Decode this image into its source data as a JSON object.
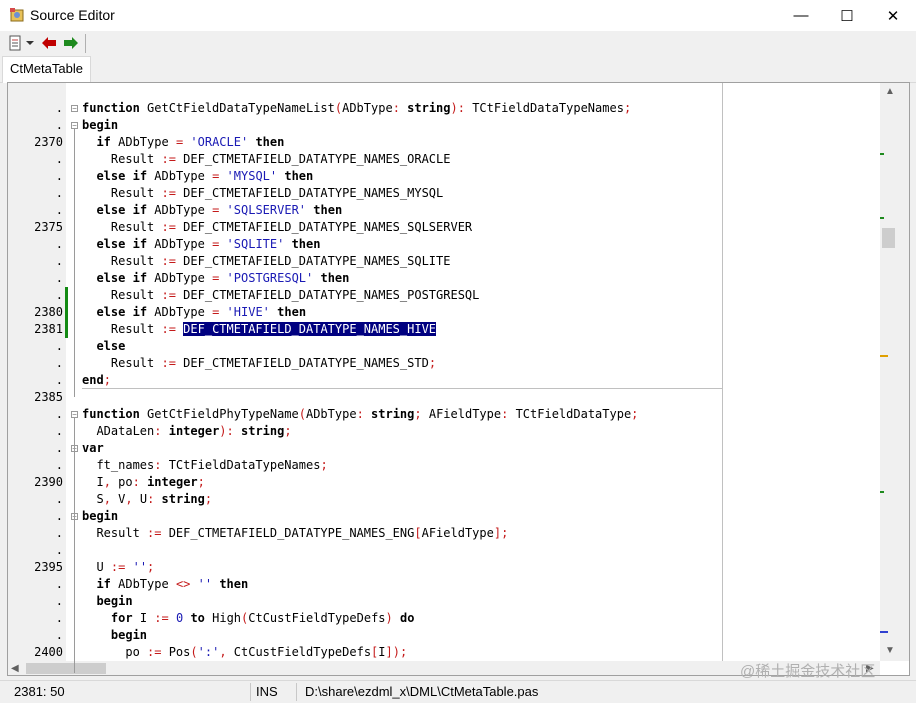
{
  "window": {
    "title": "Source Editor",
    "minimize_glyph": "—",
    "maximize_glyph": "☐",
    "close_glyph": "✕"
  },
  "toolbar": {
    "menu_icon": "document-list-icon",
    "dropdown_icon": "chevron-down-icon",
    "back_icon": "arrow-left-icon",
    "forward_icon": "arrow-right-icon",
    "back_color": "#c00000",
    "forward_color": "#1e8a1e"
  },
  "tab": {
    "label": "CtMetaTable"
  },
  "gutter": [
    ".",
    ".",
    "2370",
    ".",
    ".",
    ".",
    ".",
    "2375",
    ".",
    ".",
    ".",
    ".",
    "2380",
    "2381",
    ".",
    ".",
    ".",
    "2385",
    ".",
    ".",
    ".",
    ".",
    "2390",
    ".",
    ".",
    ".",
    ".",
    "2395",
    ".",
    ".",
    ".",
    ".",
    "2400"
  ],
  "code": [
    [
      {
        "t": "function",
        "k": "kw"
      },
      {
        "t": " GetCtFieldDataTypeNameList"
      },
      {
        "t": "(",
        "k": "sym"
      },
      {
        "t": "ADbType"
      },
      {
        "t": ":",
        "k": "sym"
      },
      {
        "t": " "
      },
      {
        "t": "string",
        "k": "kw"
      },
      {
        "t": ")",
        "k": "sym"
      },
      {
        "t": ":",
        "k": "sym"
      },
      {
        "t": " TCtFieldDataTypeNames"
      },
      {
        "t": ";",
        "k": "sym"
      }
    ],
    [
      {
        "t": "begin",
        "k": "kw"
      }
    ],
    [
      {
        "t": "  "
      },
      {
        "t": "if",
        "k": "kw"
      },
      {
        "t": " ADbType "
      },
      {
        "t": "=",
        "k": "sym"
      },
      {
        "t": " "
      },
      {
        "t": "'ORACLE'",
        "k": "str"
      },
      {
        "t": " "
      },
      {
        "t": "then",
        "k": "kw"
      }
    ],
    [
      {
        "t": "    Result "
      },
      {
        "t": ":=",
        "k": "sym"
      },
      {
        "t": " DEF_CTMETAFIELD_DATATYPE_NAMES_ORACLE"
      }
    ],
    [
      {
        "t": "  "
      },
      {
        "t": "else",
        "k": "kw"
      },
      {
        "t": " "
      },
      {
        "t": "if",
        "k": "kw"
      },
      {
        "t": " ADbType "
      },
      {
        "t": "=",
        "k": "sym"
      },
      {
        "t": " "
      },
      {
        "t": "'MYSQL'",
        "k": "str"
      },
      {
        "t": " "
      },
      {
        "t": "then",
        "k": "kw"
      }
    ],
    [
      {
        "t": "    Result "
      },
      {
        "t": ":=",
        "k": "sym"
      },
      {
        "t": " DEF_CTMETAFIELD_DATATYPE_NAMES_MYSQL"
      }
    ],
    [
      {
        "t": "  "
      },
      {
        "t": "else",
        "k": "kw"
      },
      {
        "t": " "
      },
      {
        "t": "if",
        "k": "kw"
      },
      {
        "t": " ADbType "
      },
      {
        "t": "=",
        "k": "sym"
      },
      {
        "t": " "
      },
      {
        "t": "'SQLSERVER'",
        "k": "str"
      },
      {
        "t": " "
      },
      {
        "t": "then",
        "k": "kw"
      }
    ],
    [
      {
        "t": "    Result "
      },
      {
        "t": ":=",
        "k": "sym"
      },
      {
        "t": " DEF_CTMETAFIELD_DATATYPE_NAMES_SQLSERVER"
      }
    ],
    [
      {
        "t": "  "
      },
      {
        "t": "else",
        "k": "kw"
      },
      {
        "t": " "
      },
      {
        "t": "if",
        "k": "kw"
      },
      {
        "t": " ADbType "
      },
      {
        "t": "=",
        "k": "sym"
      },
      {
        "t": " "
      },
      {
        "t": "'SQLITE'",
        "k": "str"
      },
      {
        "t": " "
      },
      {
        "t": "then",
        "k": "kw"
      }
    ],
    [
      {
        "t": "    Result "
      },
      {
        "t": ":=",
        "k": "sym"
      },
      {
        "t": " DEF_CTMETAFIELD_DATATYPE_NAMES_SQLITE"
      }
    ],
    [
      {
        "t": "  "
      },
      {
        "t": "else",
        "k": "kw"
      },
      {
        "t": " "
      },
      {
        "t": "if",
        "k": "kw"
      },
      {
        "t": " ADbType "
      },
      {
        "t": "=",
        "k": "sym"
      },
      {
        "t": " "
      },
      {
        "t": "'POSTGRESQL'",
        "k": "str"
      },
      {
        "t": " "
      },
      {
        "t": "then",
        "k": "kw"
      }
    ],
    [
      {
        "t": "    Result "
      },
      {
        "t": ":=",
        "k": "sym"
      },
      {
        "t": " DEF_CTMETAFIELD_DATATYPE_NAMES_POSTGRESQL"
      }
    ],
    [
      {
        "t": "  "
      },
      {
        "t": "else",
        "k": "kw"
      },
      {
        "t": " "
      },
      {
        "t": "if",
        "k": "kw"
      },
      {
        "t": " ADbType "
      },
      {
        "t": "=",
        "k": "sym"
      },
      {
        "t": " "
      },
      {
        "t": "'HIVE'",
        "k": "str"
      },
      {
        "t": " "
      },
      {
        "t": "then",
        "k": "kw"
      }
    ],
    [
      {
        "t": "    Result "
      },
      {
        "t": ":=",
        "k": "sym"
      },
      {
        "t": " "
      },
      {
        "t": "DEF_CTMETAFIELD_DATATYPE_NAMES_HIVE",
        "k": "sel"
      }
    ],
    [
      {
        "t": "  "
      },
      {
        "t": "else",
        "k": "kw"
      }
    ],
    [
      {
        "t": "    Result "
      },
      {
        "t": ":=",
        "k": "sym"
      },
      {
        "t": " DEF_CTMETAFIELD_DATATYPE_NAMES_STD"
      },
      {
        "t": ";",
        "k": "sym"
      }
    ],
    [
      {
        "t": "end",
        "k": "kw"
      },
      {
        "t": ";",
        "k": "sym"
      }
    ],
    [
      {
        "t": ""
      }
    ],
    [
      {
        "t": "function",
        "k": "kw"
      },
      {
        "t": " GetCtFieldPhyTypeName"
      },
      {
        "t": "(",
        "k": "sym"
      },
      {
        "t": "ADbType"
      },
      {
        "t": ":",
        "k": "sym"
      },
      {
        "t": " "
      },
      {
        "t": "string",
        "k": "kw"
      },
      {
        "t": ";",
        "k": "sym"
      },
      {
        "t": " AFieldType"
      },
      {
        "t": ":",
        "k": "sym"
      },
      {
        "t": " TCtFieldDataType"
      },
      {
        "t": ";",
        "k": "sym"
      }
    ],
    [
      {
        "t": "  ADataLen"
      },
      {
        "t": ":",
        "k": "sym"
      },
      {
        "t": " "
      },
      {
        "t": "integer",
        "k": "kw"
      },
      {
        "t": ")",
        "k": "sym"
      },
      {
        "t": ":",
        "k": "sym"
      },
      {
        "t": " "
      },
      {
        "t": "string",
        "k": "kw"
      },
      {
        "t": ";",
        "k": "sym"
      }
    ],
    [
      {
        "t": "var",
        "k": "kw"
      }
    ],
    [
      {
        "t": "  ft_names"
      },
      {
        "t": ":",
        "k": "sym"
      },
      {
        "t": " TCtFieldDataTypeNames"
      },
      {
        "t": ";",
        "k": "sym"
      }
    ],
    [
      {
        "t": "  I"
      },
      {
        "t": ",",
        "k": "sym"
      },
      {
        "t": " po"
      },
      {
        "t": ":",
        "k": "sym"
      },
      {
        "t": " "
      },
      {
        "t": "integer",
        "k": "kw"
      },
      {
        "t": ";",
        "k": "sym"
      }
    ],
    [
      {
        "t": "  S"
      },
      {
        "t": ",",
        "k": "sym"
      },
      {
        "t": " V"
      },
      {
        "t": ",",
        "k": "sym"
      },
      {
        "t": " U"
      },
      {
        "t": ":",
        "k": "sym"
      },
      {
        "t": " "
      },
      {
        "t": "string",
        "k": "kw"
      },
      {
        "t": ";",
        "k": "sym"
      }
    ],
    [
      {
        "t": "begin",
        "k": "kw"
      }
    ],
    [
      {
        "t": "  Result "
      },
      {
        "t": ":=",
        "k": "sym"
      },
      {
        "t": " DEF_CTMETAFIELD_DATATYPE_NAMES_ENG"
      },
      {
        "t": "[",
        "k": "sym"
      },
      {
        "t": "AFieldType"
      },
      {
        "t": "]",
        "k": "sym"
      },
      {
        "t": ";",
        "k": "sym"
      }
    ],
    [
      {
        "t": ""
      }
    ],
    [
      {
        "t": "  U "
      },
      {
        "t": ":=",
        "k": "sym"
      },
      {
        "t": " "
      },
      {
        "t": "''",
        "k": "str"
      },
      {
        "t": ";",
        "k": "sym"
      }
    ],
    [
      {
        "t": "  "
      },
      {
        "t": "if",
        "k": "kw"
      },
      {
        "t": " ADbType "
      },
      {
        "t": "<>",
        "k": "sym"
      },
      {
        "t": " "
      },
      {
        "t": "''",
        "k": "str"
      },
      {
        "t": " "
      },
      {
        "t": "then",
        "k": "kw"
      }
    ],
    [
      {
        "t": "  "
      },
      {
        "t": "begin",
        "k": "kw"
      }
    ],
    [
      {
        "t": "    "
      },
      {
        "t": "for",
        "k": "kw"
      },
      {
        "t": " I "
      },
      {
        "t": ":=",
        "k": "sym"
      },
      {
        "t": " "
      },
      {
        "t": "0",
        "k": "num"
      },
      {
        "t": " "
      },
      {
        "t": "to",
        "k": "kw"
      },
      {
        "t": " High"
      },
      {
        "t": "(",
        "k": "sym"
      },
      {
        "t": "CtCustFieldTypeDefs"
      },
      {
        "t": ")",
        "k": "sym"
      },
      {
        "t": " "
      },
      {
        "t": "do",
        "k": "kw"
      }
    ],
    [
      {
        "t": "    "
      },
      {
        "t": "begin",
        "k": "kw"
      }
    ],
    [
      {
        "t": "      po "
      },
      {
        "t": ":=",
        "k": "sym"
      },
      {
        "t": " Pos"
      },
      {
        "t": "(",
        "k": "sym"
      },
      {
        "t": "':'",
        "k": "str"
      },
      {
        "t": ",",
        "k": "sym"
      },
      {
        "t": " CtCustFieldTypeDefs"
      },
      {
        "t": "[",
        "k": "sym"
      },
      {
        "t": "I"
      },
      {
        "t": "]",
        "k": "sym"
      },
      {
        "t": ")",
        "k": "sym"
      },
      {
        "t": ";",
        "k": "sym"
      }
    ]
  ],
  "status": {
    "position": "2381: 50",
    "mode": "INS",
    "file": "D:\\share\\ezdml_x\\DML\\CtMetaTable.pas"
  },
  "watermark": "@稀土掘金技术社区",
  "colors": {
    "selection": "#000080",
    "modified": "#138a13",
    "string": "#1a1ab4",
    "symbol": "#c41a1a"
  }
}
